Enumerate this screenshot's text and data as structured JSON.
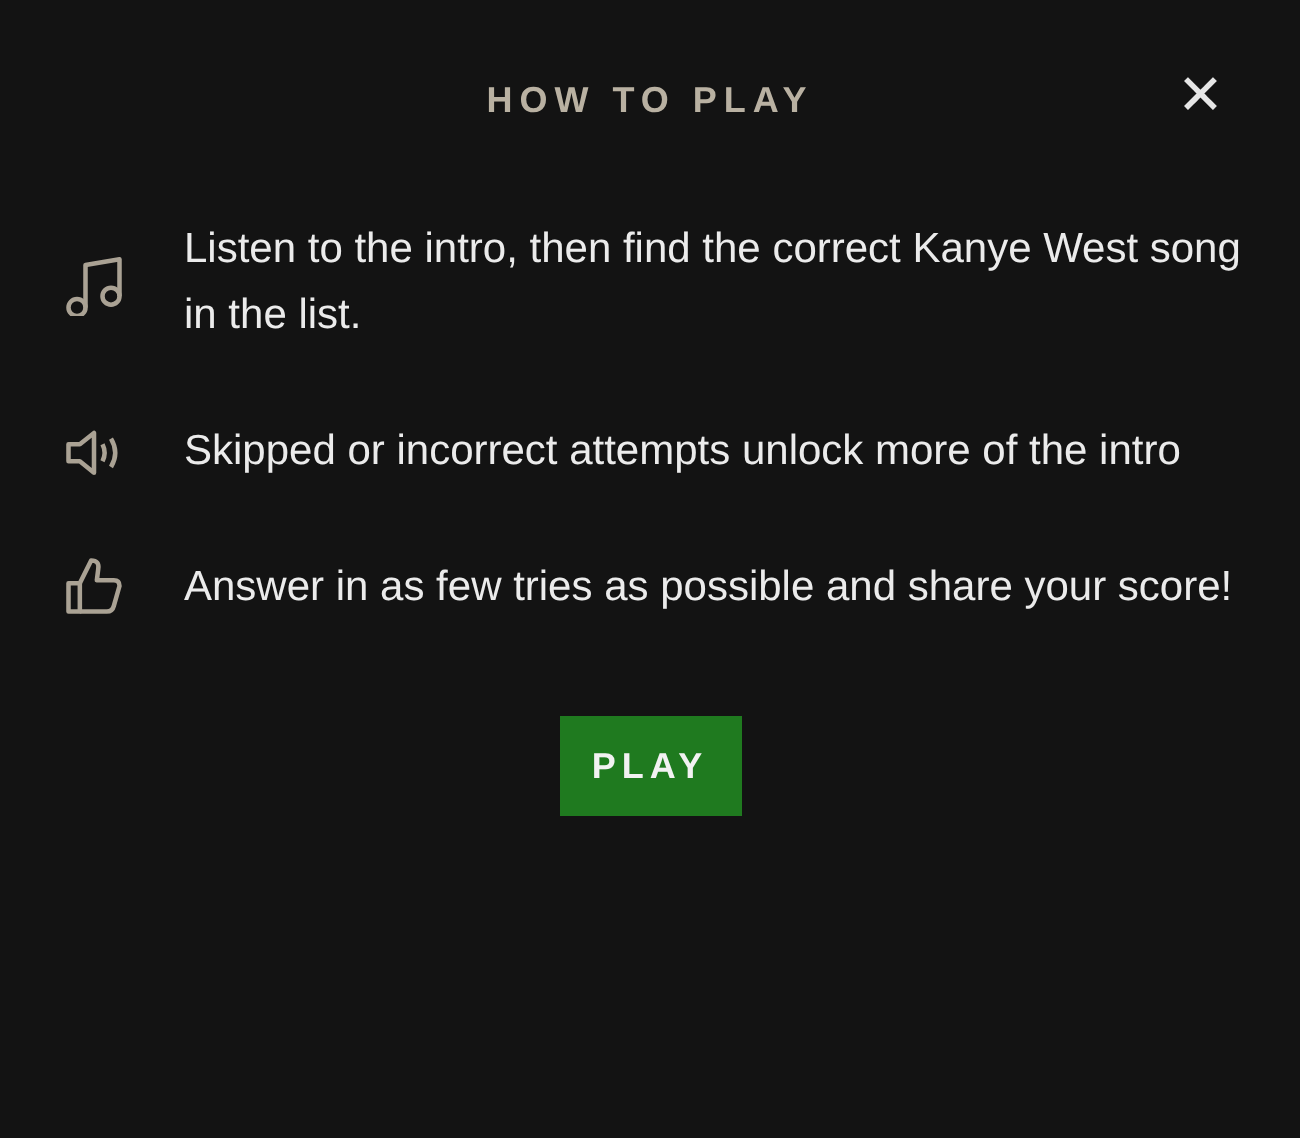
{
  "dialog": {
    "title": "HOW TO PLAY",
    "close": "✕"
  },
  "steps": [
    {
      "kind": "music",
      "text": "Listen to the intro, then find the correct Kanye West song in the list."
    },
    {
      "kind": "speaker",
      "text": "Skipped or incorrect attempts unlock more of the intro"
    },
    {
      "kind": "thumb",
      "text": "Answer in as few tries as possible and share your score!"
    }
  ],
  "button": "PLAY"
}
